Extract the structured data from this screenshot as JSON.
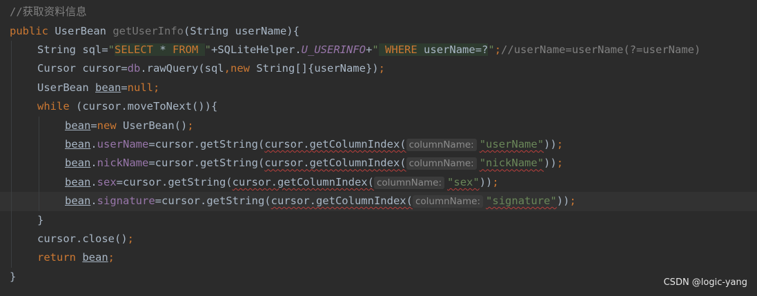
{
  "editor": {
    "lines": [
      [
        {
          "t": "//获取资料信息",
          "c": "comment"
        }
      ],
      [
        {
          "t": "public",
          "c": "keyword"
        },
        {
          "t": " UserBean ",
          "c": "ident"
        },
        {
          "t": "getUserInfo",
          "c": "method-dim"
        },
        {
          "t": "(String userName){",
          "c": "ident"
        }
      ],
      [
        {
          "t": "String sql=",
          "c": "ident"
        },
        {
          "t": "\"",
          "c": "string"
        },
        {
          "t": "SELECT",
          "c": "sql-kw"
        },
        {
          "t": " * ",
          "c": "sql-id"
        },
        {
          "t": "FROM",
          "c": "sql-kw"
        },
        {
          "t": " ",
          "c": "sql-id"
        },
        {
          "t": "\"",
          "c": "string"
        },
        {
          "t": "+SQLiteHelper.",
          "c": "ident"
        },
        {
          "t": "U_USERINFO",
          "c": "static"
        },
        {
          "t": "+",
          "c": "ident"
        },
        {
          "t": "\"",
          "c": "string"
        },
        {
          "t": " ",
          "c": "sql-id"
        },
        {
          "t": "WHERE",
          "c": "sql-kw"
        },
        {
          "t": " userName=?",
          "c": "sql-id"
        },
        {
          "t": "\"",
          "c": "string"
        },
        {
          "t": ";",
          "c": "keyword"
        },
        {
          "t": "//userName=userName(?=userName)",
          "c": "comment"
        }
      ],
      [
        {
          "t": "Cursor cursor=",
          "c": "ident"
        },
        {
          "t": "db",
          "c": "field"
        },
        {
          "t": ".rawQuery(sql",
          "c": "ident"
        },
        {
          "t": ",",
          "c": "keyword"
        },
        {
          "t": "new",
          "c": "keyword"
        },
        {
          "t": " String[]{userName})",
          "c": "ident"
        },
        {
          "t": ";",
          "c": "keyword"
        }
      ],
      [
        {
          "t": "UserBean ",
          "c": "ident"
        },
        {
          "t": "bean",
          "c": "ident",
          "u": true
        },
        {
          "t": "=",
          "c": "ident"
        },
        {
          "t": "null",
          "c": "keyword"
        },
        {
          "t": ";",
          "c": "keyword"
        }
      ],
      [
        {
          "t": "while",
          "c": "keyword"
        },
        {
          "t": " (cursor.moveToNext()){",
          "c": "ident"
        }
      ],
      [
        {
          "t": "bean",
          "c": "ident",
          "u": true
        },
        {
          "t": "=",
          "c": "ident"
        },
        {
          "t": "new",
          "c": "keyword"
        },
        {
          "t": " UserBean()",
          "c": "ident"
        },
        {
          "t": ";",
          "c": "keyword"
        }
      ],
      [
        {
          "t": "bean",
          "c": "ident",
          "u": true
        },
        {
          "t": ".",
          "c": "ident"
        },
        {
          "t": "userName",
          "c": "field"
        },
        {
          "t": "=cursor.getString(",
          "c": "ident"
        },
        {
          "t": "cursor.getColumnIndex(",
          "c": "ident",
          "sq": true
        },
        {
          "t": "columnName:",
          "c": "hint"
        },
        {
          "t": "\"userName\"",
          "c": "string",
          "sq": true
        },
        {
          "t": "))",
          "c": "ident"
        },
        {
          "t": ";",
          "c": "keyword"
        }
      ],
      [
        {
          "t": "bean",
          "c": "ident",
          "u": true
        },
        {
          "t": ".",
          "c": "ident"
        },
        {
          "t": "nickName",
          "c": "field"
        },
        {
          "t": "=cursor.getString(",
          "c": "ident"
        },
        {
          "t": "cursor.getColumnIndex(",
          "c": "ident",
          "sq": true
        },
        {
          "t": "columnName:",
          "c": "hint"
        },
        {
          "t": "\"nickName\"",
          "c": "string",
          "sq": true
        },
        {
          "t": "))",
          "c": "ident"
        },
        {
          "t": ";",
          "c": "keyword"
        }
      ],
      [
        {
          "t": "bean",
          "c": "ident",
          "u": true
        },
        {
          "t": ".",
          "c": "ident"
        },
        {
          "t": "sex",
          "c": "field"
        },
        {
          "t": "=cursor.getString(",
          "c": "ident"
        },
        {
          "t": "cursor.getColumnIndex(",
          "c": "ident",
          "sq": true
        },
        {
          "t": "columnName:",
          "c": "hint"
        },
        {
          "t": "\"sex\"",
          "c": "string",
          "sq": true
        },
        {
          "t": "))",
          "c": "ident"
        },
        {
          "t": ";",
          "c": "keyword"
        }
      ],
      [
        {
          "t": "bean",
          "c": "ident",
          "u": true
        },
        {
          "t": ".",
          "c": "ident"
        },
        {
          "t": "signature",
          "c": "field"
        },
        {
          "t": "=cursor.getString(",
          "c": "ident"
        },
        {
          "t": "cursor.getColumnIndex(",
          "c": "ident",
          "sq": true
        },
        {
          "t": "columnName:",
          "c": "hint"
        },
        {
          "t": "\"signature\"",
          "c": "string",
          "sq": true
        },
        {
          "t": "))",
          "c": "ident"
        },
        {
          "t": ";",
          "c": "keyword"
        }
      ],
      [
        {
          "t": "}",
          "c": "ident"
        }
      ],
      [
        {
          "t": "cursor.close()",
          "c": "ident"
        },
        {
          "t": ";",
          "c": "keyword"
        }
      ],
      [
        {
          "t": "return",
          "c": "keyword"
        },
        {
          "t": " ",
          "c": "ident"
        },
        {
          "t": "bean",
          "c": "ident",
          "u": true
        },
        {
          "t": ";",
          "c": "keyword"
        }
      ],
      [
        {
          "t": "}",
          "c": "ident"
        }
      ]
    ],
    "current_line": 10
  },
  "watermark": "CSDN @logic-yang",
  "colors": {
    "background": "#2b2b2b",
    "keyword": "#cc7832",
    "string": "#6a8759",
    "comment": "#808080",
    "field": "#9876aa",
    "text": "#a9b7c6"
  }
}
